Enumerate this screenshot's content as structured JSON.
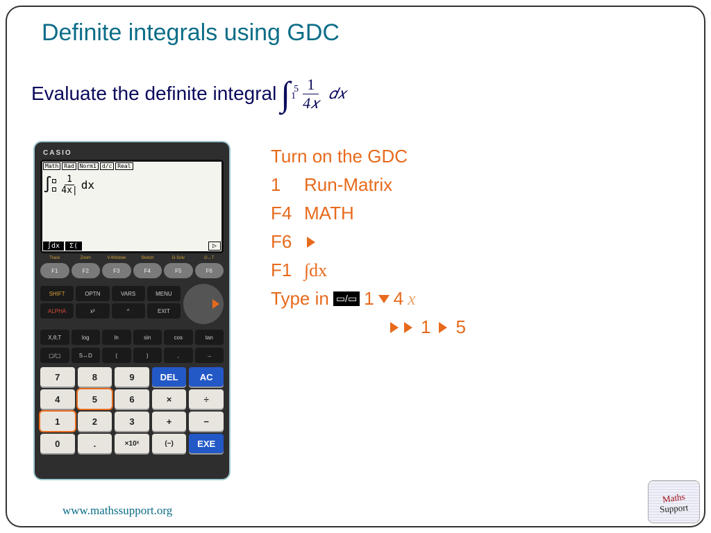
{
  "title": "Definite integrals using GDC",
  "prompt_text": "Evaluate the definite integral",
  "integral": {
    "upper": "5",
    "lower": "1",
    "numerator": "1",
    "denominator": "4𝑥",
    "dx": "𝑑𝑥"
  },
  "calculator": {
    "brand": "CASIO",
    "topbar": [
      "Math",
      "Rad",
      "Norm1",
      "d/c",
      "Real"
    ],
    "screen_int": "∫",
    "screen_num": "1",
    "screen_den": "4x|",
    "screen_dx": "dx",
    "screen_tab1": "∫dx",
    "screen_tab2": "Σ(",
    "screen_play": "▷",
    "flabels": [
      "Trace",
      "Zoom",
      "V-Window",
      "Sketch",
      "G-Solv",
      "G↔T"
    ],
    "fkeys": [
      "F1",
      "F2",
      "F3",
      "F4",
      "F5",
      "F6"
    ],
    "mrow1": [
      "SHIFT",
      "OPTN",
      "VARS",
      "MENU"
    ],
    "mrow2": [
      "ALPHA",
      "x²",
      "^",
      "EXIT"
    ],
    "trig_labels": [
      "X,θ,T",
      "log",
      "ln",
      "sin",
      "cos",
      "tan"
    ],
    "sym_row": [
      "▢/▢",
      "S↔D",
      "(",
      ")",
      ",",
      "→"
    ],
    "numpad": [
      [
        "7",
        "8",
        "9",
        "DEL",
        "AC"
      ],
      [
        "4",
        "5",
        "6",
        "×",
        "÷"
      ],
      [
        "1",
        "2",
        "3",
        "+",
        "−"
      ],
      [
        "0",
        ".",
        "×10ˣ",
        "(−)",
        "EXE"
      ]
    ]
  },
  "steps": {
    "s0": "Turn on the GDC",
    "s1k": "1",
    "s1v": "Run-Matrix",
    "s2k": "F4",
    "s2v": "MATH",
    "s3k": "F6",
    "s4k": "F1",
    "s4v": "∫dx",
    "s5": "Type in",
    "type_1": "1",
    "type_4": "4",
    "type_x": "x",
    "type_low": "1",
    "type_up": "5",
    "frac_key": "▭/▭"
  },
  "footer": "www.mathssupport.org",
  "logo": {
    "l1": "Maths",
    "l2": "Support"
  }
}
